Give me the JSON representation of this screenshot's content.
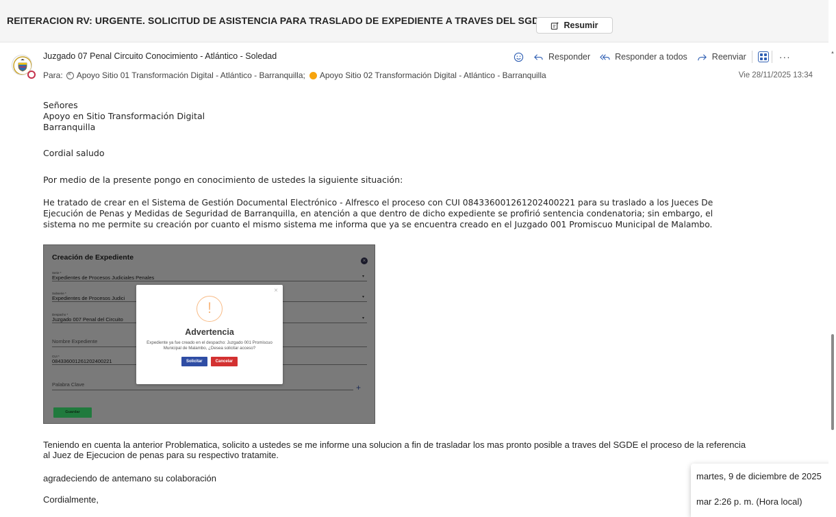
{
  "subject": "REITERACION RV: URGENTE. SOLICITUD DE ASISTENCIA PARA TRASLADO DE EXPEDIENTE A TRAVES DEL SGDE",
  "summarize_label": "Resumir",
  "sender": "Juzgado 07 Penal Circuito Conocimiento - Atlántico - Soledad",
  "recipients": {
    "prefix": "Para:",
    "r1": "Apoyo Sitio 01 Transformación Digital - Atlántico - Barranquilla;",
    "r2": "Apoyo Sitio 02 Transformación Digital - Atlántico - Barranquilla"
  },
  "date": "Vie 28/11/2025 13:34",
  "actions": {
    "reply": "Responder",
    "reply_all": "Responder a todos",
    "forward": "Reenviar",
    "more": "···"
  },
  "body": {
    "greeting": [
      "Señores",
      "Apoyo en Sitio Transformación Digital",
      "Barranquilla"
    ],
    "salute": "Cordial saludo",
    "intro": "Por medio de la presente pongo en conocimiento de ustedes la siguiente situación:",
    "p1_lines": [
      "He tratado de crear en el Sistema de Gestión Documental Electrónico - Alfresco el proceso con CUI 084336001261202400221 para su traslado a los Jueces De",
      "Ejecución de Penas y Medidas de Seguridad de Barranquilla, en atención a que dentro de dicho expediente se profirió sentencia condenatoria; sin embargo, el",
      "sistema no me permite su creación por cuanto el mismo sistema  me informa que ya se encuentra creado en el Juzgado 001 Promiscuo Municipal de Malambo."
    ],
    "p2_lines": [
      "Teniendo en cuenta la anterior Problematica, solicito a ustedes se me informe una solucion a fin de trasladar los mas pronto posible a traves del SGDE el proceso de la referencia",
      "al Juez de Ejecucion de penas para su respectivo tratamite."
    ],
    "thanks": "agradeciendo de antemano su colaboración",
    "closing": "Cordialmente,"
  },
  "embedded": {
    "title": "Creación de Expediente",
    "fields": [
      {
        "label": "Serie *",
        "value": "Expedientes de Procesos Judiciales Penales"
      },
      {
        "label": "Subserie *",
        "value": "Expedientes de Procesos Judici"
      },
      {
        "label": "Despacho *",
        "value": "Juzgado 007 Penal del Circuito"
      },
      {
        "label": "",
        "value": "Nombre Expediente"
      },
      {
        "label": "CUI *",
        "value": "084336001261202400221"
      },
      {
        "label": "",
        "value": "Palabra Clave"
      }
    ],
    "save_label": "Guardar",
    "dialog": {
      "icon": "!",
      "title": "Advertencia",
      "message": "Expediente ya fue creado en el despacho: Juzgado 001 Promiscuo Municipal de Malambo, ¿Desea solicitar acceso?",
      "confirm": "Solicitar",
      "cancel": "Cancelar"
    }
  },
  "tooltip": {
    "line1": "martes, 9 de diciembre de 2025",
    "line2": "mar 2:26 p. m. (Hora local)"
  }
}
